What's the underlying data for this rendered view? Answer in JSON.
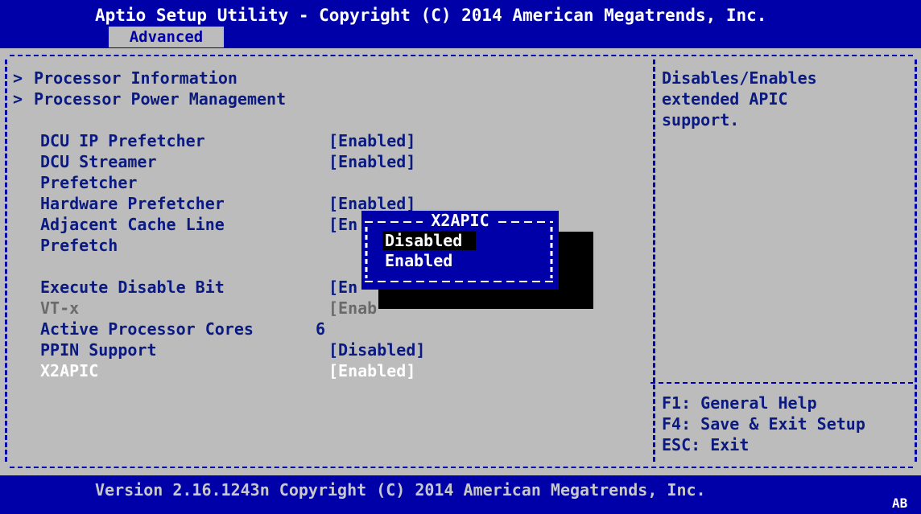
{
  "header": {
    "title": "Aptio Setup Utility - Copyright (C) 2014 American Megatrends, Inc.",
    "tab": "Advanced"
  },
  "menu": [
    {
      "label": "Processor Information",
      "submenu": true
    },
    {
      "label": "Processor Power Management",
      "submenu": true
    }
  ],
  "settings": {
    "dcu_ip": {
      "label": "DCU IP Prefetcher",
      "value": "[Enabled]"
    },
    "dcu_streamer": {
      "label1": "DCU Streamer",
      "label2": "Prefetcher",
      "value": "[Enabled]"
    },
    "hw_prefetcher": {
      "label": "Hardware Prefetcher",
      "value": "[Enabled]"
    },
    "adjacent": {
      "label1": "Adjacent Cache Line",
      "label2": "Prefetch",
      "value": "[En"
    },
    "execute_disable": {
      "label": "Execute Disable Bit",
      "value": "[En"
    },
    "vtx": {
      "label": "VT-x",
      "value": "[Enab"
    },
    "cores": {
      "label": "Active Processor Cores",
      "value": "6"
    },
    "ppin": {
      "label": "PPIN Support",
      "value": "[Disabled]"
    },
    "x2apic": {
      "label": "X2APIC",
      "value": "[Enabled]"
    }
  },
  "submenu_marker": ">",
  "help": {
    "description": [
      "Disables/Enables",
      "extended APIC",
      "support."
    ],
    "keys": [
      "F1: General Help",
      "F4: Save & Exit Setup",
      "ESC: Exit"
    ]
  },
  "popup": {
    "title": "X2APIC",
    "options": [
      "Disabled",
      "Enabled"
    ],
    "selected": "Disabled"
  },
  "footer": {
    "version": "Version 2.16.1243n Copyright (C) 2014 American Megatrends, Inc.",
    "badge": "AB"
  },
  "colors": {
    "background": "#bcbcbc",
    "bar": "#0000a8",
    "text": "#0a1a80",
    "highlight": "#ffffff",
    "disabled": "#6a6a6a"
  }
}
